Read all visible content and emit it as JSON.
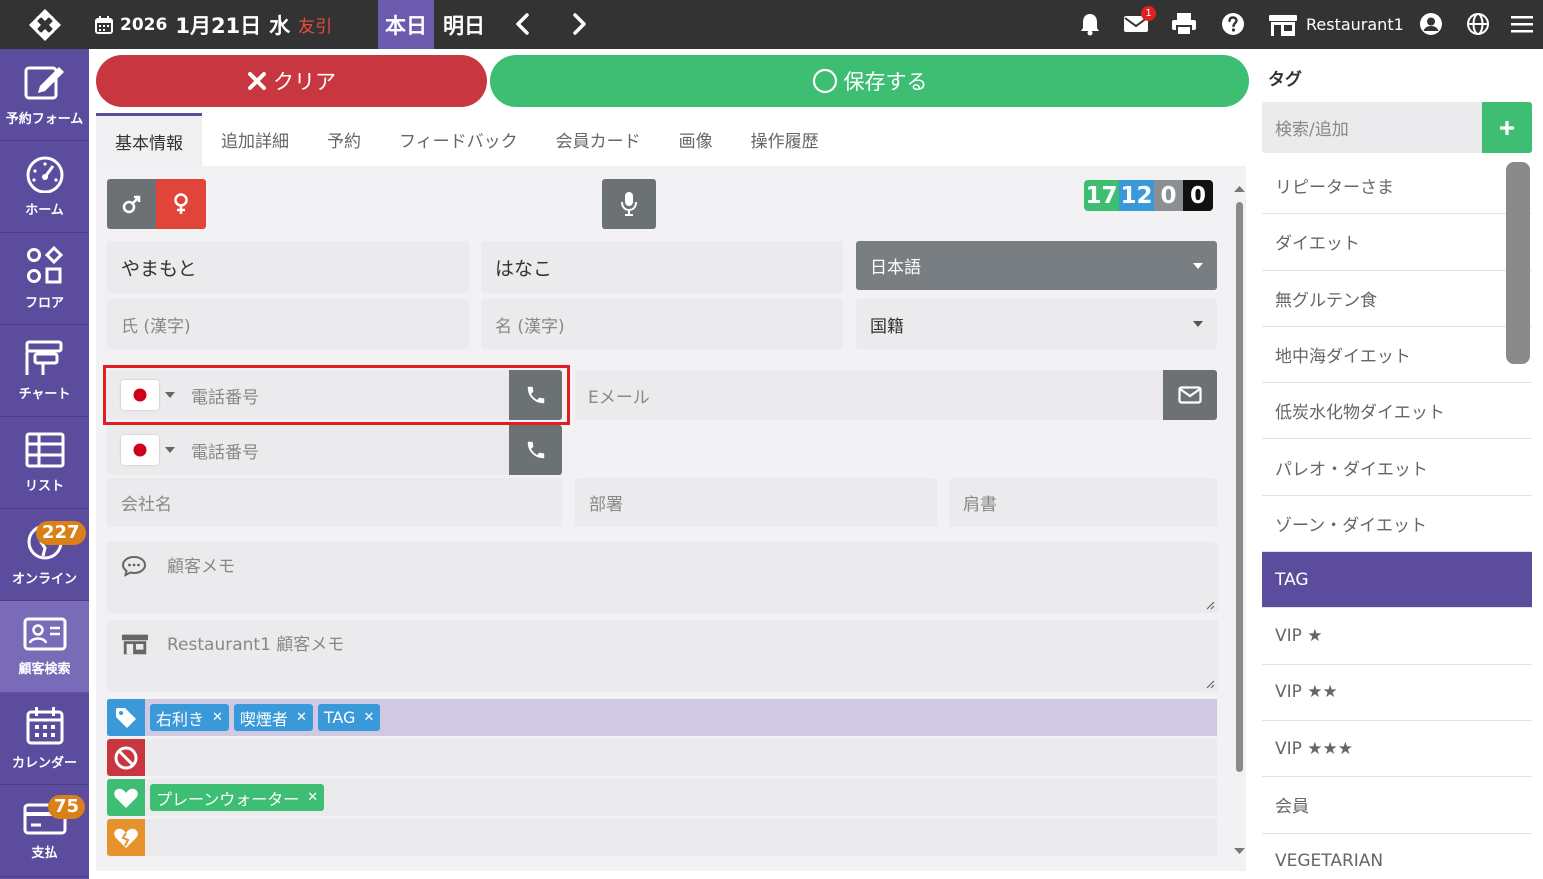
{
  "header": {
    "date_year": "2026",
    "date_md": "1月21日",
    "date_dow": "水",
    "date_rokuyo": "友引",
    "today_label": "本日",
    "tomorrow_label": "明日",
    "mail_badge": "1",
    "restaurant": "Restaurant1"
  },
  "sidebar": {
    "items": [
      {
        "label": "予約フォーム"
      },
      {
        "label": "ホーム"
      },
      {
        "label": "フロア"
      },
      {
        "label": "チャート"
      },
      {
        "label": "リスト"
      },
      {
        "label": "オンライン",
        "badge": "227"
      },
      {
        "label": "顧客検索",
        "active": true
      },
      {
        "label": "カレンダー"
      },
      {
        "label": "支払",
        "badge": "75"
      }
    ]
  },
  "actions": {
    "clear_label": "クリア",
    "save_label": "保存する"
  },
  "tabs": [
    "基本情報",
    "追加詳細",
    "予約",
    "フィードバック",
    "会員カード",
    "画像",
    "操作履歴"
  ],
  "counts": [
    "17",
    "12",
    "0",
    "0"
  ],
  "form": {
    "last_name": "やまもと",
    "first_name": "はなこ",
    "language": "日本語",
    "last_name_kanji_ph": "氏 (漢字)",
    "first_name_kanji_ph": "名 (漢字)",
    "nationality": "国籍",
    "phone1_ph": "電話番号",
    "phone2_ph": "電話番号",
    "email_ph": "Eメール",
    "company_ph": "会社名",
    "department_ph": "部署",
    "title_ph": "肩書",
    "customer_memo_ph": "顧客メモ",
    "restaurant_memo_ph": "Restaurant1 顧客メモ"
  },
  "tag_rows": {
    "tags": [
      "右利き",
      "喫煙者",
      "TAG"
    ],
    "favorites": [
      "プレーンウォーター"
    ]
  },
  "tag_panel": {
    "title": "タグ",
    "search_ph": "検索/追加",
    "items": [
      "リピーターさま",
      "ダイエット",
      "無グルテン食",
      "地中海ダイエット",
      "低炭水化物ダイエット",
      "パレオ・ダイエット",
      "ゾーン・ダイエット",
      "TAG",
      "VIP ★",
      "VIP ★★",
      "VIP ★★★",
      "会員",
      "VEGETARIAN"
    ],
    "selected": "TAG"
  },
  "colors": {
    "topbar": "#333333",
    "sidebar": "#5c4c9e",
    "clear": "#c8373f",
    "save": "#3dbe73",
    "tag_chip": "#3a9ad9",
    "fav_chip": "#3dbe73",
    "highlight": "#e02020"
  }
}
